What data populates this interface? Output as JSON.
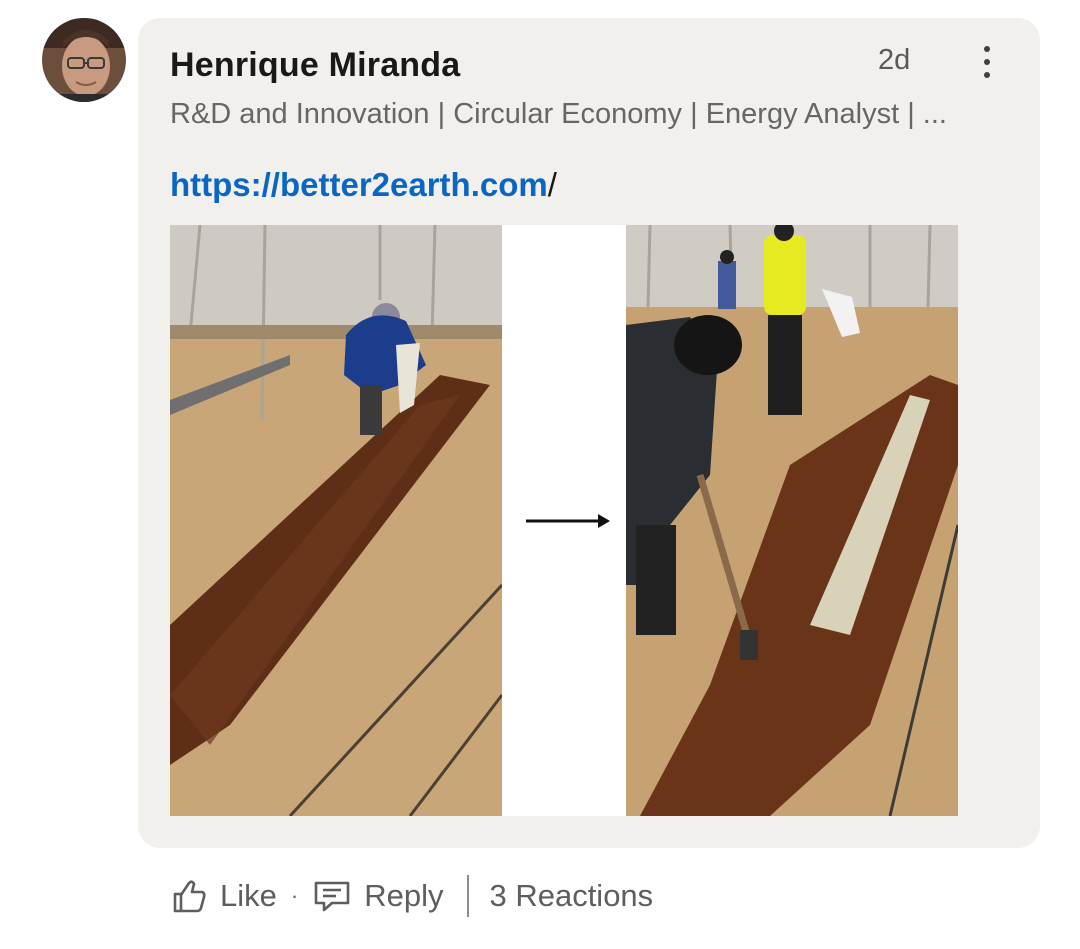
{
  "comment": {
    "author": {
      "name": "Henrique Miranda",
      "headline": "R&D and Innovation | Circular Economy | Energy Analyst | ...",
      "avatar_icon": "profile-photo"
    },
    "timestamp": "2d",
    "more_icon": "vertical-ellipsis-icon",
    "link_text": "https://better2earth.com",
    "link_suffix": "/",
    "image": {
      "description_icon": "trench-soil-comparison-photo",
      "arrow_icon": "right-arrow-icon"
    }
  },
  "actions": {
    "like_label": "Like",
    "like_icon": "thumbs-up-icon",
    "separator": "·",
    "reply_label": "Reply",
    "reply_icon": "speech-bubble-icon",
    "reactions_label": "3 Reactions"
  },
  "colors": {
    "bubble_bg": "#f2f0ec",
    "link": "#0a66c2",
    "name": "#191919",
    "secondary": "#666666"
  }
}
